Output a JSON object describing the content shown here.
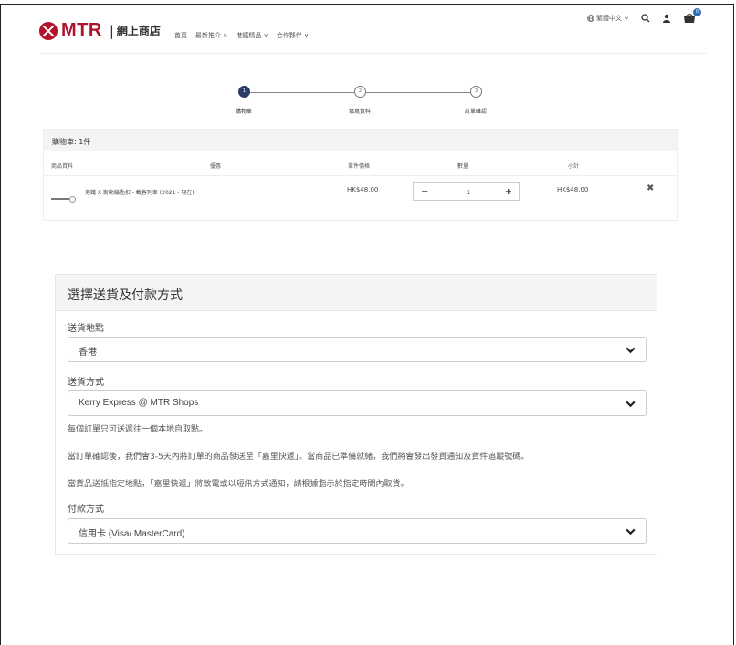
{
  "header": {
    "brand": "MTR",
    "separator": "|",
    "subtitle": "網上商店",
    "nav": [
      "首頁",
      "最新推介 ∨",
      "港鐵精品 ∨",
      "合作夥伴 ∨"
    ],
    "language": "繁體中文",
    "cart_count": "0"
  },
  "stepper": {
    "steps": [
      {
        "num": "1",
        "label": "購物車"
      },
      {
        "num": "2",
        "label": "填寫資料"
      },
      {
        "num": "3",
        "label": "訂單確認"
      }
    ]
  },
  "cart": {
    "title": "購物車: 1件",
    "columns": [
      "商品資料",
      "優惠",
      "單件價格",
      "數量",
      "小計"
    ],
    "items": [
      {
        "name": "港鐵 X 街動鑰匙扣 - 載客列車 (2021 - 現在)",
        "unit_price": "HK$48.00",
        "quantity": "1",
        "subtotal": "HK$48.00"
      }
    ]
  },
  "shipping": {
    "title": "選擇送貨及付款方式",
    "location_label": "送貨地點",
    "location_value": "香港",
    "method_label": "送貨方式",
    "method_value": "Kerry Express @ MTR Shops",
    "notes": [
      "每個訂單只可送遞往一個本地自取點。",
      "當訂單確認後，我們會3-5天內將訂單的商品發送至「嘉里快遞」。當商品已準備就緒，我們將會發出發貨通知及貨件追蹤號碼。",
      "當貨品送抵指定地點，「嘉里快遞」將致電或以短訊方式通知，請根據指示於指定時間內取貨。"
    ],
    "payment_label": "付款方式",
    "payment_value": "信用卡 (Visa/ MasterCard)"
  },
  "colors": {
    "brand_red": "#b0132b",
    "step_active": "#2b3a67",
    "cart_badge": "#2b6fb8"
  }
}
